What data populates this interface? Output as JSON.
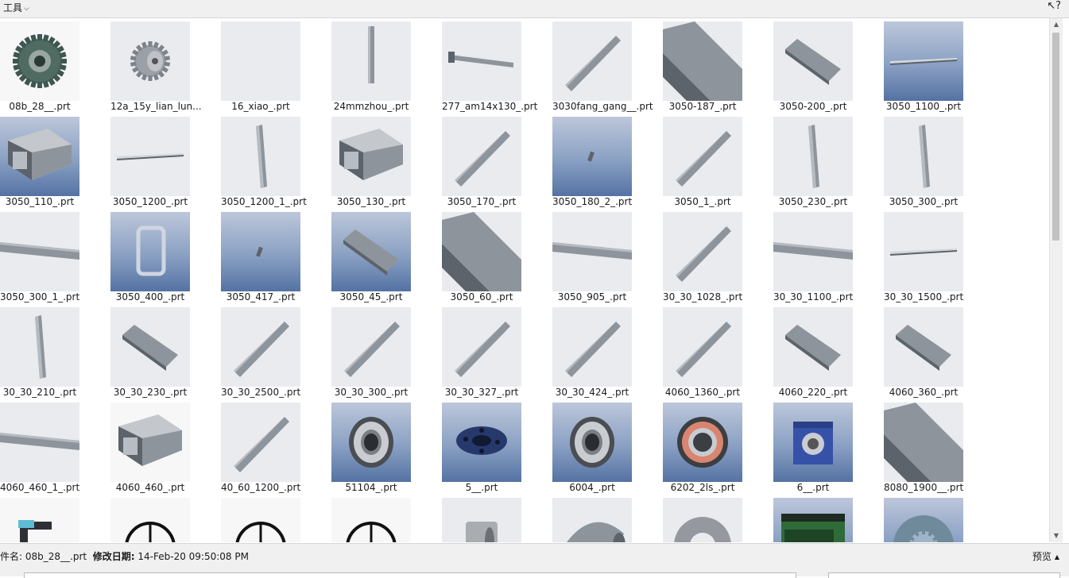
{
  "toolbar": {
    "tools_label": "工具",
    "help_icon": "help-cursor-icon",
    "help_text": "?"
  },
  "status": {
    "filename_label": "件名:",
    "filename_value": "08b_28__.prt",
    "modified_label": "修改日期:",
    "modified_value": "14-Feb-20 09:50:08 PM",
    "preview_label": "预览"
  },
  "colors": {
    "thumb_grey": "#e9ebef",
    "thumb_blue": "#5472a3",
    "part_grey": "#8e949c"
  },
  "files": [
    {
      "name": "08b_28__.prt",
      "icon": "sprocket-icon",
      "bg": "white"
    },
    {
      "name": "12a_15y_lian_lun...",
      "icon": "sprocket-small-icon",
      "bg": "grey"
    },
    {
      "name": "16_xiao_.prt",
      "icon": "blank-part-icon",
      "bg": "grey"
    },
    {
      "name": "24mmzhou_.prt",
      "icon": "shaft-vertical-icon",
      "bg": "grey"
    },
    {
      "name": "277_am14x130_.prt",
      "icon": "pin-icon",
      "bg": "grey"
    },
    {
      "name": "3030fang_gang__.prt",
      "icon": "diagonal-bar-icon",
      "bg": "grey"
    },
    {
      "name": "3050-187_.prt",
      "icon": "large-tube-icon",
      "bg": "grey"
    },
    {
      "name": "3050-200_.prt",
      "icon": "short-tube-icon",
      "bg": "grey"
    },
    {
      "name": "3050_1100_.prt",
      "icon": "thin-bar-icon",
      "bg": "blue"
    },
    {
      "name": "3050_110_.prt",
      "icon": "box-tube-icon",
      "bg": "blue"
    },
    {
      "name": "3050_1200_.prt",
      "icon": "thin-bar-icon",
      "bg": "grey"
    },
    {
      "name": "3050_1200_1_.prt",
      "icon": "vertical-bar-icon",
      "bg": "grey"
    },
    {
      "name": "3050_130_.prt",
      "icon": "box-tube-icon",
      "bg": "grey"
    },
    {
      "name": "3050_170_.prt",
      "icon": "diagonal-bar-icon",
      "bg": "grey"
    },
    {
      "name": "3050_180_2_.prt",
      "icon": "small-part-icon",
      "bg": "blue"
    },
    {
      "name": "3050_1_.prt",
      "icon": "diagonal-bar-icon",
      "bg": "grey"
    },
    {
      "name": "3050_230_.prt",
      "icon": "vertical-bar-icon",
      "bg": "grey"
    },
    {
      "name": "3050_300_.prt",
      "icon": "vertical-bar-icon",
      "bg": "grey"
    },
    {
      "name": "3050_300_1_.prt",
      "icon": "horizontal-bar-icon",
      "bg": "grey"
    },
    {
      "name": "3050_400_.prt",
      "icon": "rect-frame-icon",
      "bg": "blue"
    },
    {
      "name": "3050_417_.prt",
      "icon": "small-part-icon",
      "bg": "blue"
    },
    {
      "name": "3050_45_.prt",
      "icon": "short-tube-icon",
      "bg": "blue"
    },
    {
      "name": "3050_60_.prt",
      "icon": "large-tube-icon",
      "bg": "grey"
    },
    {
      "name": "3050_905_.prt",
      "icon": "horizontal-bar-icon",
      "bg": "grey"
    },
    {
      "name": "30_30_1028_.prt",
      "icon": "diagonal-bar-icon",
      "bg": "grey"
    },
    {
      "name": "30_30_1100_.prt",
      "icon": "horizontal-bar-icon",
      "bg": "grey"
    },
    {
      "name": "30_30_1500_.prt",
      "icon": "thin-bar-icon",
      "bg": "grey"
    },
    {
      "name": "30_30_210_.prt",
      "icon": "vertical-bar-icon",
      "bg": "grey"
    },
    {
      "name": "30_30_230_.prt",
      "icon": "short-tube-icon",
      "bg": "grey"
    },
    {
      "name": "30_30_2500_.prt",
      "icon": "diagonal-bar-icon",
      "bg": "grey"
    },
    {
      "name": "30_30_300_.prt",
      "icon": "diagonal-bar-icon",
      "bg": "grey"
    },
    {
      "name": "30_30_327_.prt",
      "icon": "diagonal-bar-icon",
      "bg": "grey"
    },
    {
      "name": "30_30_424_.prt",
      "icon": "diagonal-bar-icon",
      "bg": "grey"
    },
    {
      "name": "4060_1360_.prt",
      "icon": "diagonal-bar-icon",
      "bg": "grey"
    },
    {
      "name": "4060_220_.prt",
      "icon": "short-tube-icon",
      "bg": "grey"
    },
    {
      "name": "4060_360_.prt",
      "icon": "short-tube-icon",
      "bg": "grey"
    },
    {
      "name": "4060_460_1_.prt",
      "icon": "horizontal-bar-icon",
      "bg": "grey"
    },
    {
      "name": "4060_460_.prt",
      "icon": "box-tube-icon",
      "bg": "white"
    },
    {
      "name": "40_60_1200_.prt",
      "icon": "diagonal-bar-icon",
      "bg": "grey"
    },
    {
      "name": "51104_.prt",
      "icon": "bearing-icon",
      "bg": "blue"
    },
    {
      "name": "5__.prt",
      "icon": "flange-icon",
      "bg": "blue"
    },
    {
      "name": "6004_.prt",
      "icon": "bearing-icon",
      "bg": "blue"
    },
    {
      "name": "6202_2ls_.prt",
      "icon": "bearing-red-icon",
      "bg": "blue"
    },
    {
      "name": "6__.prt",
      "icon": "gearbox-icon",
      "bg": "blue"
    },
    {
      "name": "8080_1900__.prt",
      "icon": "large-tube-icon",
      "bg": "grey"
    },
    {
      "name": "",
      "icon": "bracket-icon",
      "bg": "white"
    },
    {
      "name": "",
      "icon": "wheel-icon",
      "bg": "white"
    },
    {
      "name": "",
      "icon": "wheel-icon",
      "bg": "white"
    },
    {
      "name": "",
      "icon": "wheel-icon",
      "bg": "white"
    },
    {
      "name": "",
      "icon": "bushing-icon",
      "bg": "grey"
    },
    {
      "name": "",
      "icon": "elbow-icon",
      "bg": "grey"
    },
    {
      "name": "",
      "icon": "washer-icon",
      "bg": "grey"
    },
    {
      "name": "",
      "icon": "pcb-icon",
      "bg": "blue"
    },
    {
      "name": "",
      "icon": "spline-icon",
      "bg": "blue"
    }
  ]
}
